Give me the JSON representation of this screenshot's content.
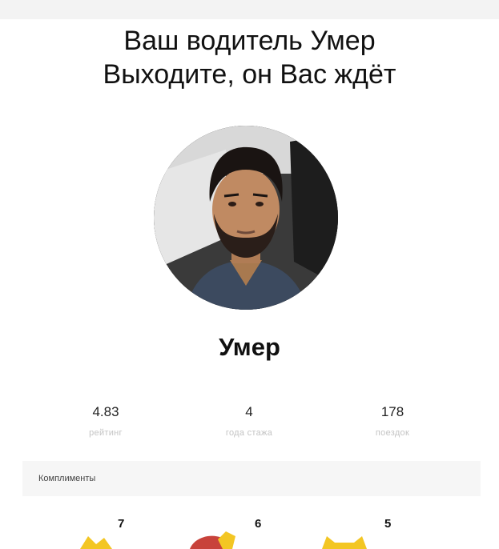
{
  "header": {
    "line1": "Ваш водитель Умер",
    "line2": "Выходите, он Вас ждёт"
  },
  "driver": {
    "name": "Умер",
    "avatar_icon": "driver-photo"
  },
  "stats": [
    {
      "value": "4.83",
      "label": "рейтинг"
    },
    {
      "value": "4",
      "label": "года стажа"
    },
    {
      "value": "178",
      "label": "поездок"
    }
  ],
  "compliments": {
    "title": "Комплименты",
    "counts": [
      "7",
      "6",
      "5"
    ],
    "icons": [
      "yellow-sticker-icon",
      "red-yellow-sticker-icon",
      "yellow-cat-sticker-icon"
    ]
  }
}
